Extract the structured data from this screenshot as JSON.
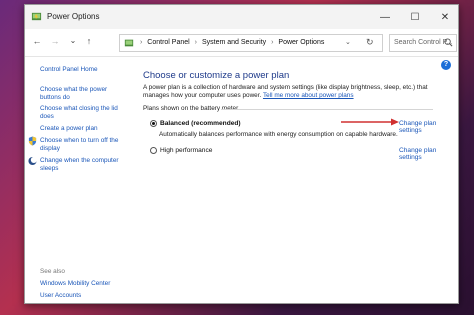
{
  "window": {
    "title": "Power Options",
    "controls": {
      "minimize": "—",
      "maximize": "☐",
      "close": "✕"
    }
  },
  "navbar": {
    "back": "←",
    "forward": "→",
    "recent": "⌄",
    "up": "↑",
    "breadcrumbs": [
      "Control Panel",
      "System and Security",
      "Power Options"
    ],
    "separator": "›",
    "dropdown": "⌄",
    "refresh": "↻",
    "search_placeholder": "Search Control P..."
  },
  "sidebar": {
    "home": "Control Panel Home",
    "items": [
      {
        "label": "Choose what the power buttons do"
      },
      {
        "label": "Choose what closing the lid does"
      },
      {
        "label": "Create a power plan"
      },
      {
        "label": "Choose when to turn off the display",
        "icon": "shield-icon"
      },
      {
        "label": "Change when the computer sleeps",
        "icon": "moon-icon"
      }
    ],
    "see_also": "See also",
    "see_also_items": [
      "Windows Mobility Center",
      "User Accounts"
    ]
  },
  "main": {
    "heading": "Choose or customize a power plan",
    "description": "A power plan is a collection of hardware and system settings (like display brightness, sleep, etc.) that manages how your computer uses power.",
    "description_link": "Tell me more about power plans",
    "group_label": "Plans shown on the battery meter",
    "help": "?",
    "plans": [
      {
        "name": "Balanced (recommended)",
        "selected": true,
        "description": "Automatically balances performance with energy consumption on capable hardware.",
        "link": "Change plan settings"
      },
      {
        "name": "High performance",
        "selected": false,
        "link": "Change plan settings"
      }
    ],
    "arrow_color": "#d03030"
  }
}
